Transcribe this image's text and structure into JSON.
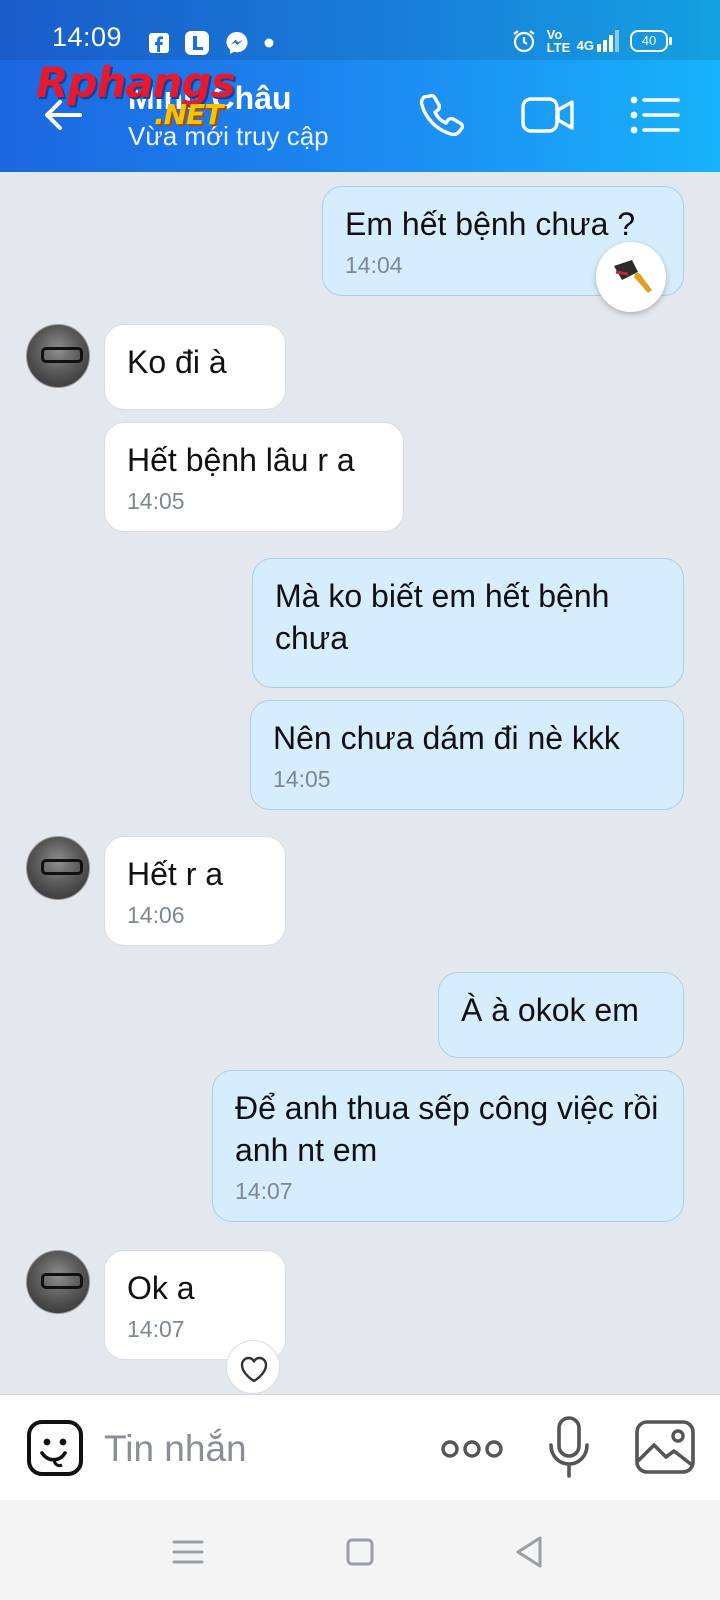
{
  "status_bar": {
    "time": "14:09",
    "battery": "40",
    "network": "4G",
    "volte": "Vo LTE",
    "notification_icons": [
      "facebook-icon",
      "app-l-icon",
      "messenger-icon",
      "dot-icon"
    ],
    "system_icons": [
      "alarm-icon",
      "volte-icon",
      "signal-icon",
      "battery-icon"
    ]
  },
  "header": {
    "contact_name": "Minh Châu",
    "contact_status": "Vừa mới truy cập",
    "watermark": "Rphangs",
    "watermark_suffix": ".NET",
    "buttons": [
      "back-icon",
      "phone-icon",
      "video-call-icon",
      "menu-icon"
    ],
    "accent_color": "#1c8cf2"
  },
  "messages": [
    {
      "side": "me",
      "text": "Em hết bệnh chưa ?",
      "time": "14:04",
      "reaction": "knife-icon"
    },
    {
      "side": "them",
      "text": "Ko đi à",
      "time": ""
    },
    {
      "side": "them",
      "text": "Hết bệnh lâu r a",
      "time": "14:05"
    },
    {
      "side": "me",
      "text": "Mà ko biết em hết bệnh chưa",
      "time": ""
    },
    {
      "side": "me",
      "text": "Nên chưa dám đi nè kkk",
      "time": "14:05"
    },
    {
      "side": "them",
      "text": "Hết r a",
      "time": "14:06"
    },
    {
      "side": "me",
      "text": "À à okok em",
      "time": ""
    },
    {
      "side": "me",
      "text": "Để anh thua sếp công việc rồi anh nt em",
      "time": "14:07"
    },
    {
      "side": "them",
      "text": "Ok a",
      "time": "14:07",
      "reaction": "heart-icon"
    }
  ],
  "composer": {
    "placeholder": "Tin nhắn",
    "value": "",
    "icons": [
      "sticker-icon",
      "more-icon",
      "microphone-icon",
      "image-icon"
    ]
  },
  "nav_bar": {
    "icons": [
      "recents-icon",
      "home-icon",
      "back-triangle-icon"
    ]
  },
  "colors": {
    "my_bubble": "#d5edfc",
    "their_bubble": "#ffffff",
    "chat_background": "#e3e8ef"
  }
}
